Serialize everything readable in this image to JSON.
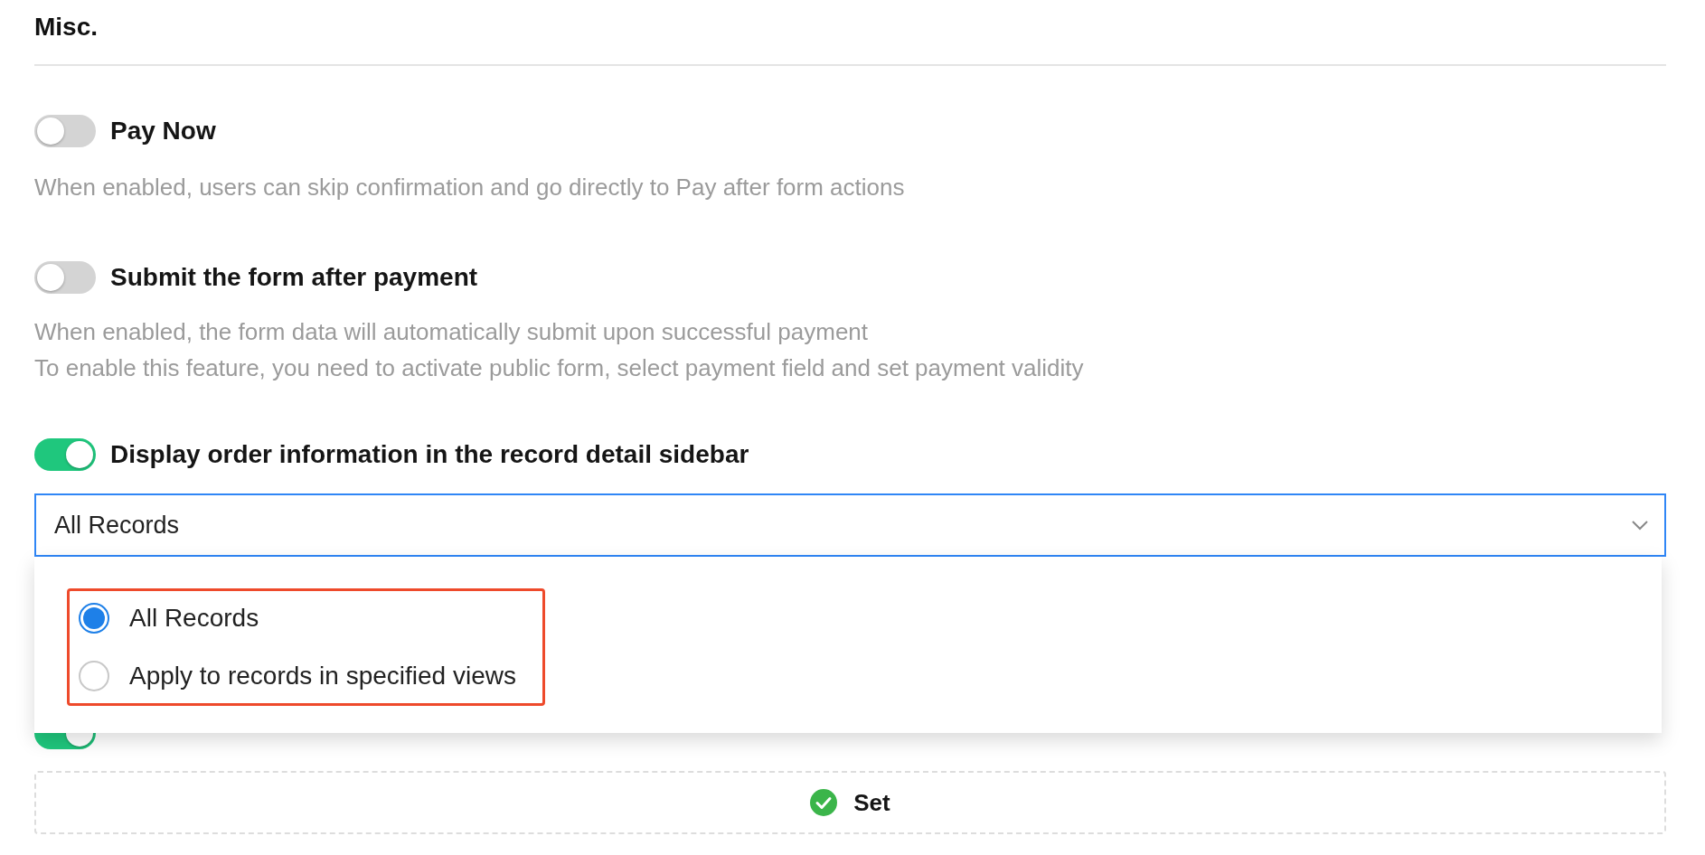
{
  "title": "Misc.",
  "settings": [
    {
      "label": "Pay Now",
      "on": false,
      "description": [
        "When enabled, users can skip confirmation and go directly to Pay after form actions"
      ]
    },
    {
      "label": "Submit the form after payment",
      "on": false,
      "description": [
        "When enabled, the form data will automatically submit upon successful payment",
        "To enable this feature, you need to activate public form, select payment field and set payment validity"
      ]
    },
    {
      "label": "Display order information in the record detail sidebar",
      "on": true
    }
  ],
  "record_scope": {
    "value": "All Records",
    "expanded": true,
    "options": [
      {
        "label": "All Records",
        "selected": true
      },
      {
        "label": "Apply to records in specified views",
        "selected": false
      }
    ]
  },
  "option_mapping": {
    "on": true
  },
  "set_button": {
    "label": "Set"
  }
}
